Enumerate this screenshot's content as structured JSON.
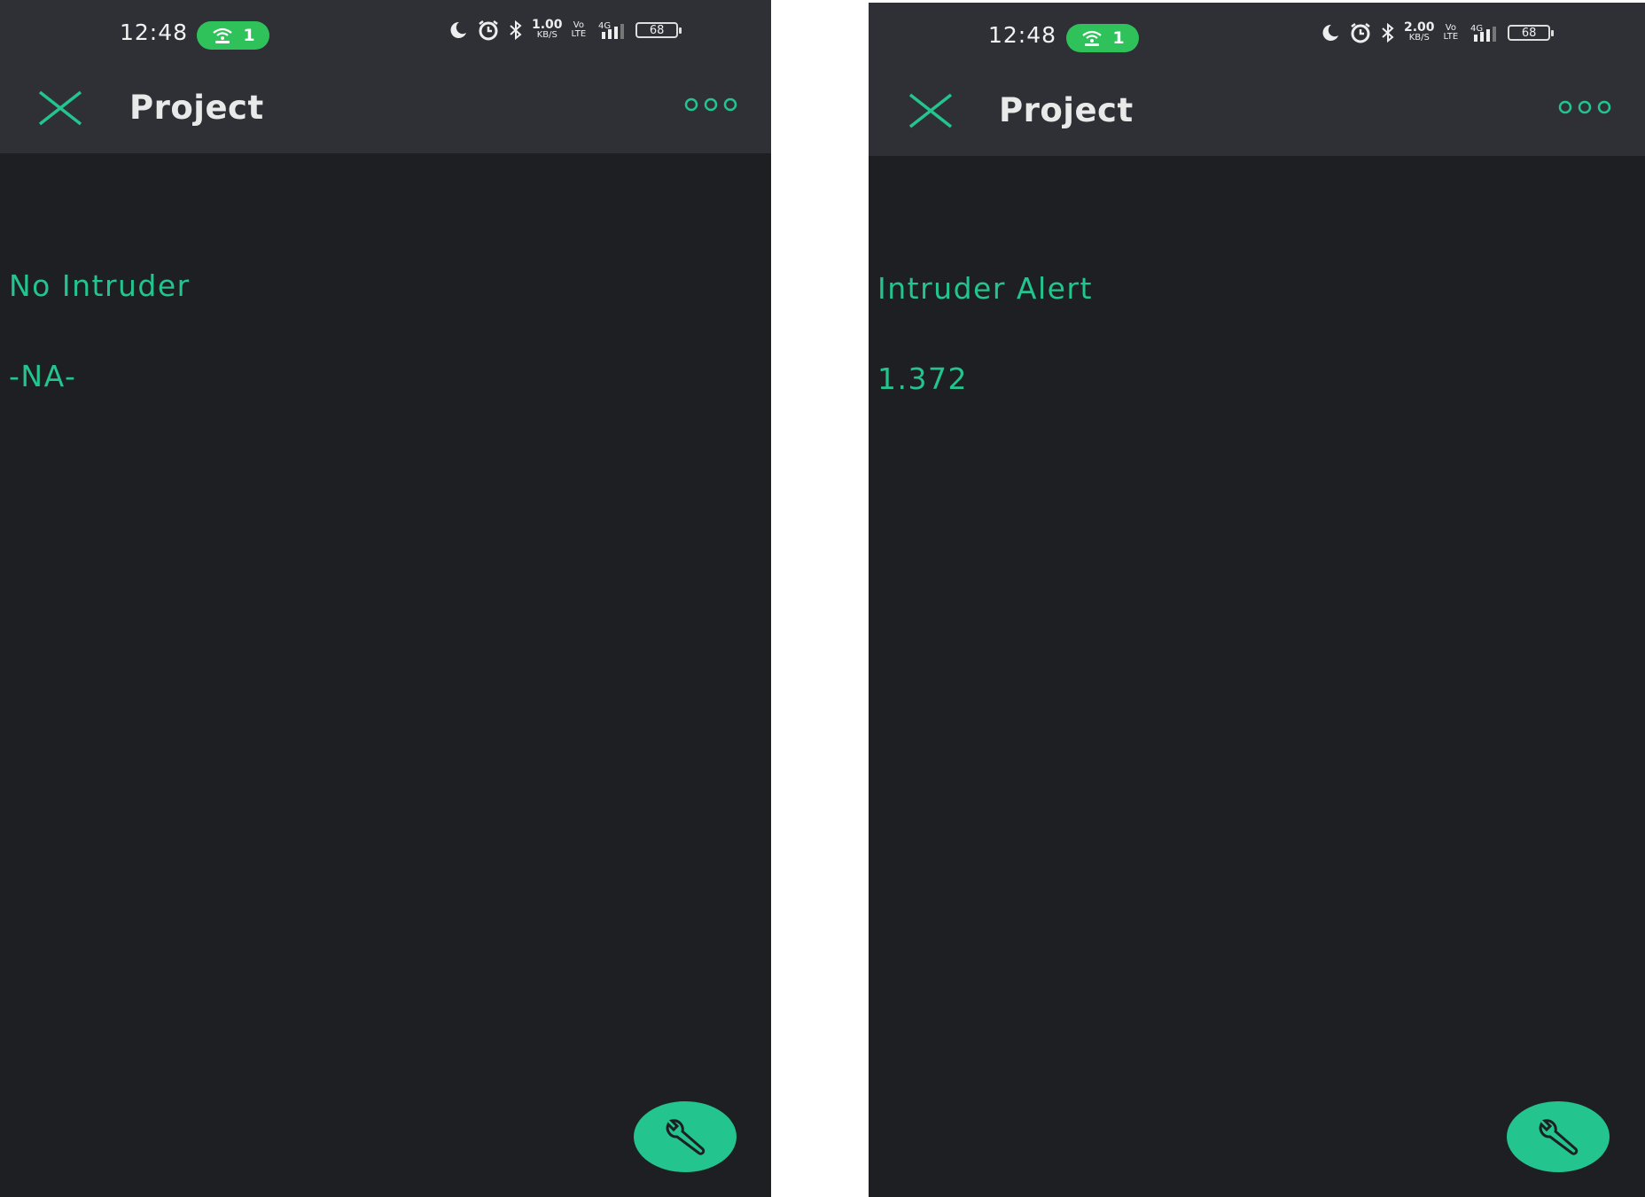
{
  "colors": {
    "accent": "#23c48e",
    "background": "#1e1f23",
    "bar": "#2e3035",
    "hotspot": "#2fc25b"
  },
  "screens": [
    {
      "status": {
        "time": "12:48",
        "hotspot_count": "1",
        "net_speed_value": "1.00",
        "net_speed_unit": "KB/S",
        "volte_top": "Vo",
        "volte_bottom": "LTE",
        "network": "4G",
        "battery": "68"
      },
      "app_bar": {
        "title": "Project",
        "close_icon": "close-icon",
        "more_icon": "more-dots-icon"
      },
      "widgets": {
        "label": "No Intruder",
        "value": "-NA-"
      },
      "fab_icon": "wrench-icon"
    },
    {
      "status": {
        "time": "12:48",
        "hotspot_count": "1",
        "net_speed_value": "2.00",
        "net_speed_unit": "KB/S",
        "volte_top": "Vo",
        "volte_bottom": "LTE",
        "network": "4G",
        "battery": "68"
      },
      "app_bar": {
        "title": "Project",
        "close_icon": "close-icon",
        "more_icon": "more-dots-icon"
      },
      "widgets": {
        "label": "Intruder Alert",
        "value": "1.372"
      },
      "fab_icon": "wrench-icon"
    }
  ]
}
